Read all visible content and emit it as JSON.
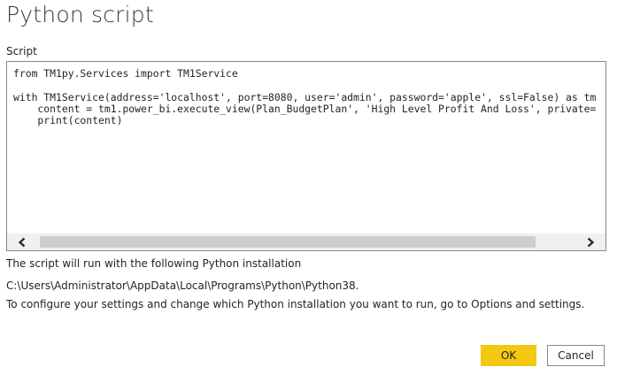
{
  "dialog": {
    "title": "Python script",
    "script_label": "Script"
  },
  "editor": {
    "lines": [
      "from TM1py.Services import TM1Service",
      "",
      "with TM1Service(address='localhost', port=8080, user='admin', password='apple', ssl=False) as tm",
      "    content = tm1.power_bi.execute_view(Plan_BudgetPlan', 'High Level Profit And Loss', private=",
      "    print(content)"
    ],
    "scrollbar": {
      "left_icon": "chevron-left-icon",
      "right_icon": "chevron-right-icon"
    }
  },
  "info": {
    "run_note": "The script will run with the following Python installation",
    "python_path": "C:\\Users\\Administrator\\AppData\\Local\\Programs\\Python\\Python38.",
    "configure_note": "To configure your settings and change which Python installation you want to run, go to Options and settings."
  },
  "buttons": {
    "ok_label": "OK",
    "cancel_label": "Cancel"
  },
  "colors": {
    "accent": "#f2c811",
    "scroll_track": "#f0f0f0",
    "scroll_thumb": "#cdcdcd",
    "border": "#8a8886"
  }
}
